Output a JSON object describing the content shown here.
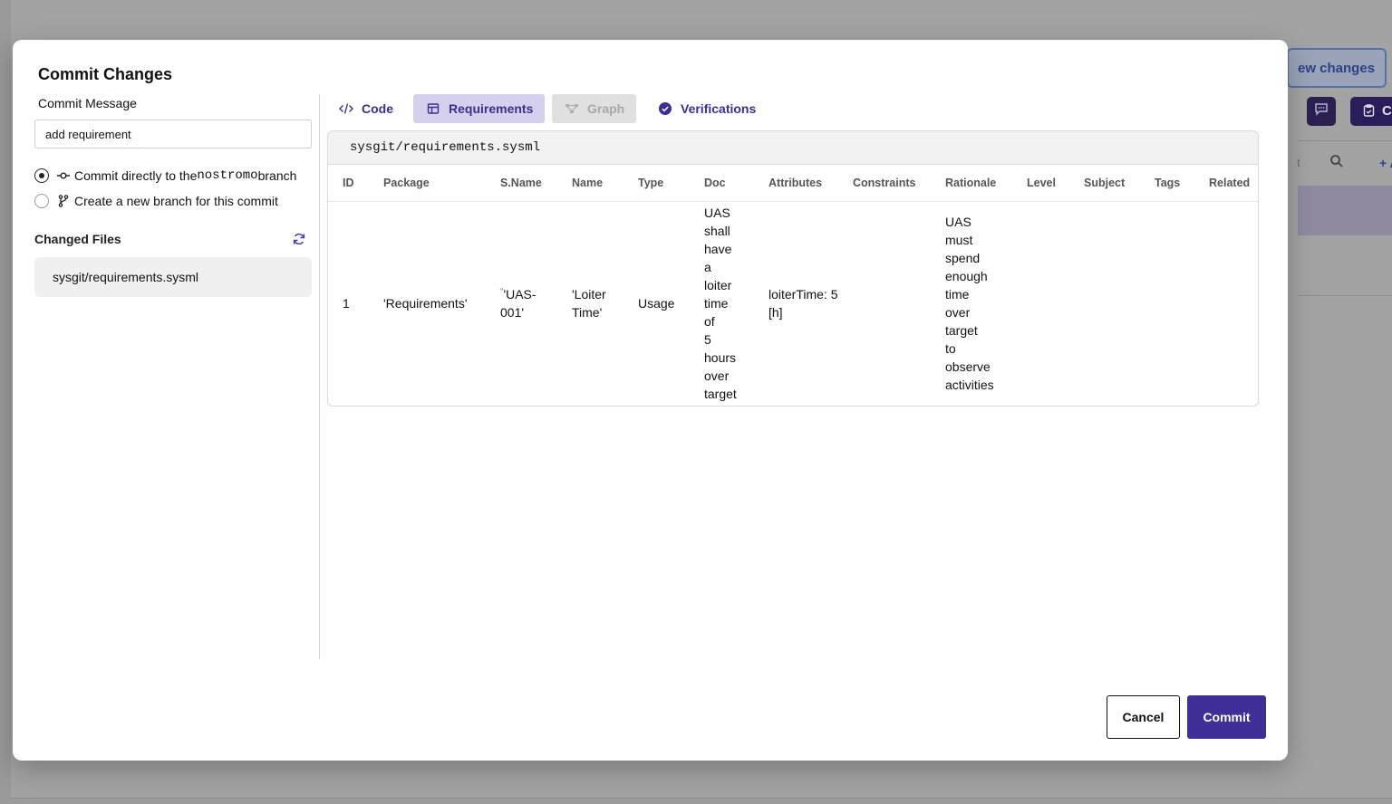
{
  "background": {
    "view_changes_button": "ew changes",
    "create_button": "Cre",
    "chat_icon": "chat-bubble-icon",
    "search_icon": "search-icon",
    "header_fragment": "t",
    "add_button": "+ Ac"
  },
  "modal": {
    "title": "Commit Changes",
    "commit_message": {
      "label": "Commit Message",
      "value": "add requirement"
    },
    "options": [
      {
        "pre": "Commit directly to the ",
        "code": "nostromo",
        "post": " branch",
        "checked": true,
        "icon": "commit-icon"
      },
      {
        "pre": "Create a new branch for this commit",
        "code": "",
        "post": "",
        "checked": false,
        "icon": "branch-icon"
      }
    ],
    "changed_files": {
      "title": "Changed Files",
      "refresh_icon": "refresh-icon",
      "files": [
        "sysgit/requirements.sysml"
      ]
    },
    "tabs": [
      {
        "label": "Code",
        "icon": "code-icon",
        "active": false,
        "disabled": false
      },
      {
        "label": "Requirements",
        "icon": "table-icon",
        "active": true,
        "disabled": false
      },
      {
        "label": "Graph",
        "icon": "graph-icon",
        "active": false,
        "disabled": true
      },
      {
        "label": "Verifications",
        "icon": "check-circle-icon",
        "active": false,
        "disabled": false
      }
    ],
    "file_path": "sysgit/requirements.sysml",
    "table": {
      "columns": [
        "ID",
        "Package",
        "S.Name",
        "Name",
        "Type",
        "Doc",
        "Attributes",
        "Constraints",
        "Rationale",
        "Level",
        "Subject",
        "Tags",
        "Related"
      ],
      "row": {
        "id": "1",
        "package": "'Requirements'",
        "sname_marker": "''",
        "sname": "'UAS-001'",
        "name": "'Loiter Time'",
        "type": "Usage",
        "doc": "UAS shall have a loiter time of 5 hours over target",
        "attributes": "loiterTime: 5 [h]",
        "constraints": "",
        "rationale": "UAS must spend enough time over target to observe activities",
        "level": "",
        "subject": "",
        "tags": "",
        "related": ""
      }
    },
    "buttons": {
      "cancel": "Cancel",
      "commit": "Commit"
    },
    "colors": {
      "primary": "#3f2f96",
      "tab_active_bg": "#d5d0ee",
      "tab_text": "#3c2e91",
      "requirement_text": "#0f9a5a"
    }
  }
}
